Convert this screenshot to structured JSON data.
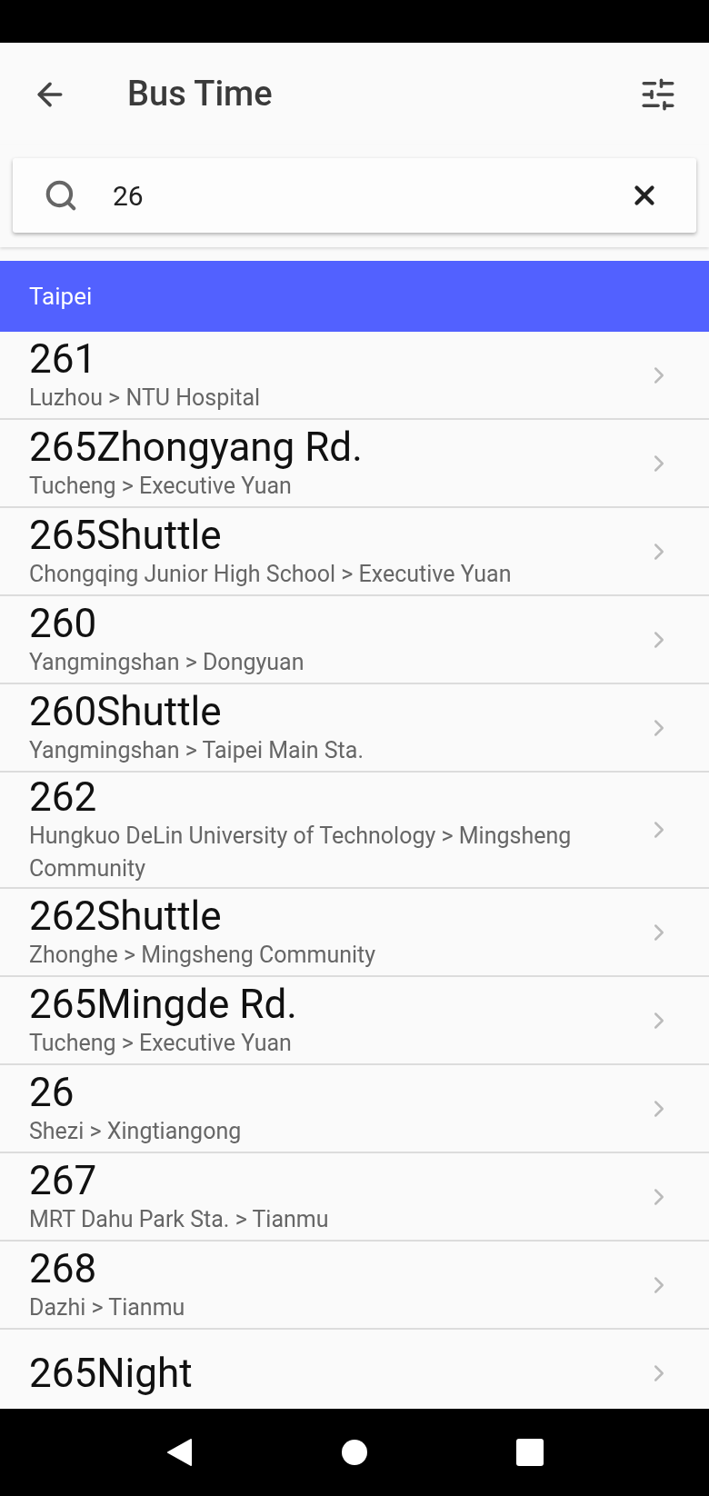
{
  "app_bar": {
    "title": "Bus Time"
  },
  "search": {
    "value": "26"
  },
  "section": {
    "title": "Taipei"
  },
  "routes": [
    {
      "name": "261",
      "path": "Luzhou > NTU Hospital"
    },
    {
      "name": "265Zhongyang Rd.",
      "path": "Tucheng > Executive Yuan"
    },
    {
      "name": "265Shuttle",
      "path": "Chongqing Junior High School > Executive Yuan"
    },
    {
      "name": "260",
      "path": "Yangmingshan > Dongyuan"
    },
    {
      "name": "260Shuttle",
      "path": "Yangmingshan > Taipei Main Sta."
    },
    {
      "name": "262",
      "path": "Hungkuo DeLin University of Technology > Mingsheng Community"
    },
    {
      "name": "262Shuttle",
      "path": "Zhonghe > Mingsheng Community"
    },
    {
      "name": "265Mingde Rd.",
      "path": "Tucheng > Executive Yuan"
    },
    {
      "name": "26",
      "path": "Shezi > Xingtiangong"
    },
    {
      "name": "267",
      "path": "MRT Dahu Park Sta. > Tianmu"
    },
    {
      "name": "268",
      "path": "Dazhi > Tianmu"
    },
    {
      "name": "265Night"
    }
  ]
}
